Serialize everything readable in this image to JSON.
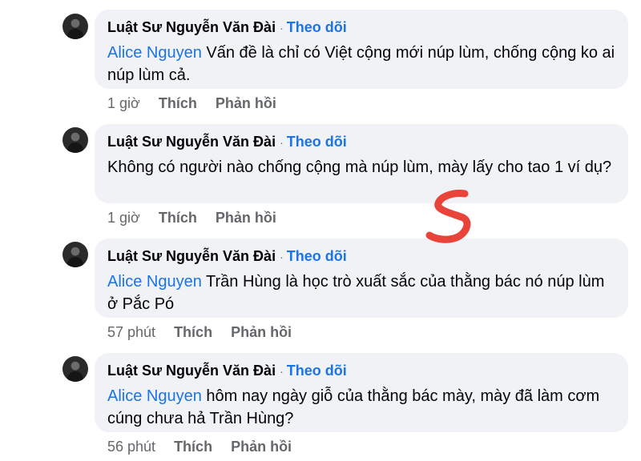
{
  "comments": [
    {
      "author": "Luật Sư Nguyễn Văn Đài",
      "separator": "·",
      "follow_label": "Theo dõi",
      "mention": "Alice Nguyen",
      "text": " Vấn đề là chỉ có Việt cộng mới núp lùm, chống cộng ko ai núp lùm cả.",
      "time": "1 giờ",
      "like_label": "Thích",
      "reply_label": "Phản hồi"
    },
    {
      "author": "Luật Sư Nguyễn Văn Đài",
      "separator": "·",
      "follow_label": "Theo dõi",
      "mention": "",
      "text": "Không có người nào chống cộng mà núp lùm, mày lấy cho tao 1 ví dụ?",
      "time": "1 giờ",
      "like_label": "Thích",
      "reply_label": "Phản hồi"
    },
    {
      "author": "Luật Sư Nguyễn Văn Đài",
      "separator": "·",
      "follow_label": "Theo dõi",
      "mention": "Alice Nguyen",
      "text": " Trần Hùng là học trò xuất sắc của thằng bác nó núp lùm ở Pắc Pó",
      "time": "57 phút",
      "like_label": "Thích",
      "reply_label": "Phản hồi"
    },
    {
      "author": "Luật Sư Nguyễn Văn Đài",
      "separator": "·",
      "follow_label": "Theo dõi",
      "mention": "Alice Nguyen",
      "text": " hôm nay ngày giỗ của thằng bác mày, mày đã làm cơm cúng chưa hả Trần Hùng?",
      "time": "56 phút",
      "like_label": "Thích",
      "reply_label": "Phản hồi"
    }
  ],
  "annotation": {
    "description": "handwritten red mark",
    "color": "#e8443a"
  },
  "colors": {
    "link": "#1b74e4",
    "bubble": "#f0f2f5",
    "meta": "#65676b"
  }
}
